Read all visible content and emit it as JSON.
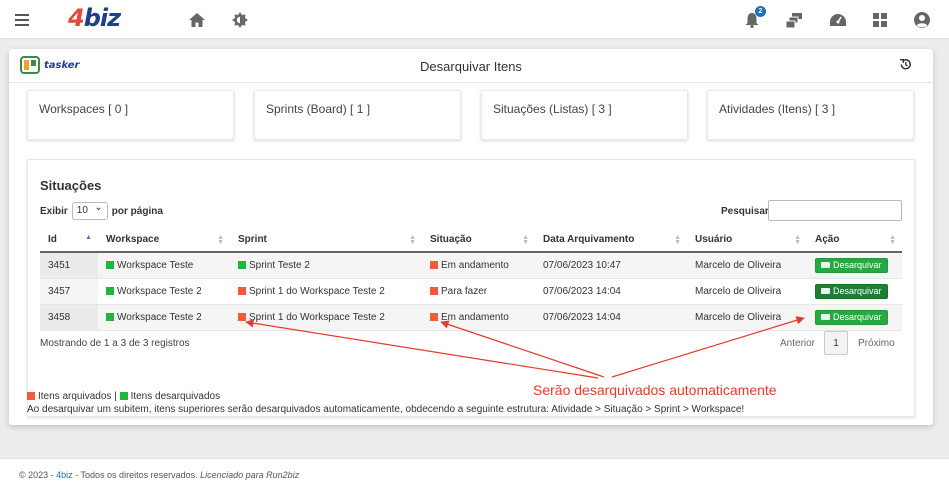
{
  "topbar": {
    "logo_number": "4",
    "logo_text": "biz",
    "notification_count": "2"
  },
  "card": {
    "brand": "tasker",
    "title": "Desarquivar Itens"
  },
  "summary": [
    {
      "label": "Workspaces [ 0 ]"
    },
    {
      "label": "Sprints (Board) [ 1 ]"
    },
    {
      "label": "Situações (Listas) [ 3 ]"
    },
    {
      "label": "Atividades (Itens) [ 3 ]"
    }
  ],
  "panel": {
    "title": "Situações",
    "show_label": "Exibir",
    "show_value": "10",
    "per_page_label": "por página",
    "search_label": "Pesquisar:",
    "search_value": ""
  },
  "table": {
    "columns": [
      "Id",
      "Workspace",
      "Sprint",
      "Situação",
      "Data Arquivamento",
      "Usuário",
      "Ação"
    ],
    "rows": [
      {
        "id": "3451",
        "workspace": "Workspace Teste",
        "workspace_status": "green",
        "sprint": "Sprint Teste 2",
        "sprint_status": "green",
        "situacao": "Em andamento",
        "situacao_status": "red",
        "data": "07/06/2023 10:47",
        "usuario": "Marcelo de Oliveira",
        "acao": "Desarquivar"
      },
      {
        "id": "3457",
        "workspace": "Workspace Teste 2",
        "workspace_status": "green",
        "sprint": "Sprint 1 do Workspace Teste 2",
        "sprint_status": "red",
        "situacao": "Para fazer",
        "situacao_status": "red",
        "data": "07/06/2023 14:04",
        "usuario": "Marcelo de Oliveira",
        "acao": "Desarquivar"
      },
      {
        "id": "3458",
        "workspace": "Workspace Teste 2",
        "workspace_status": "green",
        "sprint": "Sprint 1 do Workspace Teste 2",
        "sprint_status": "red",
        "situacao": "Em andamento",
        "situacao_status": "red",
        "data": "07/06/2023 14:04",
        "usuario": "Marcelo de Oliveira",
        "acao": "Desarquivar"
      }
    ]
  },
  "pagination": {
    "info": "Mostrando de 1 a 3 de 3 registros",
    "previous": "Anterior",
    "current": "1",
    "next": "Próximo"
  },
  "annotation": "Serão desarquivados automaticamente",
  "legend": {
    "archived": "Itens arquivados",
    "separator": "|",
    "unarchived": "Itens desarquivados"
  },
  "note": "Ao desarquivar um subitem, itens superiores serão desarquivados automaticamente, obdecendo a seguinte estrutura: Atividade > Situação > Sprint > Workspace!",
  "footer": {
    "copyright": "© 2023 -",
    "brand": "4biz",
    "rights": "- Todos os direitos reservados.",
    "license": "Licenciado para Run2biz"
  },
  "colors": {
    "archived": "#f25a3c",
    "unarchived": "#22b53a",
    "annotation": "#e53b2a",
    "button": "#28a745"
  }
}
